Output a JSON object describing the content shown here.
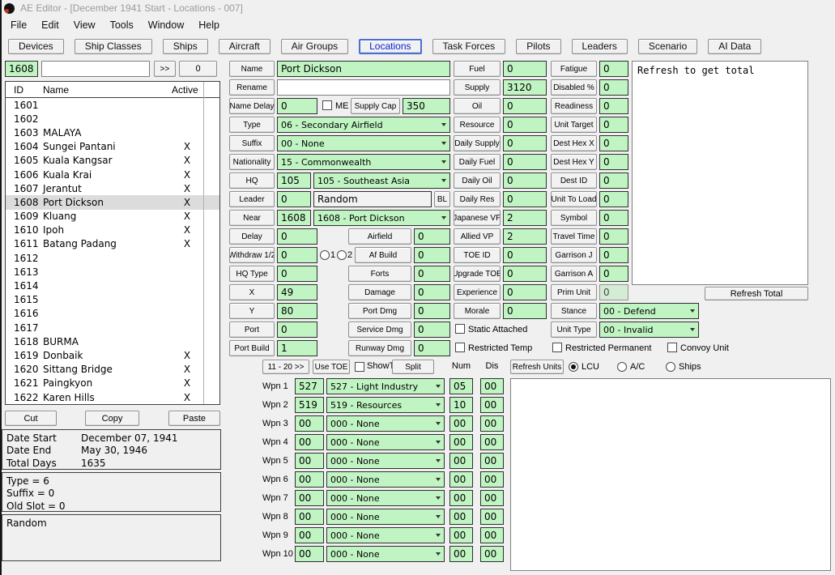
{
  "window": {
    "title": "AE Editor - [December 1941 Start - Locations - 007]"
  },
  "menu": {
    "items": [
      "File",
      "Edit",
      "View",
      "Tools",
      "Window",
      "Help"
    ]
  },
  "tabs": {
    "items": [
      {
        "label": "Devices"
      },
      {
        "label": "Ship Classes"
      },
      {
        "label": "Ships"
      },
      {
        "label": "Aircraft"
      },
      {
        "label": "Air Groups"
      },
      {
        "label": "Locations",
        "active": true
      },
      {
        "label": "Task Forces"
      },
      {
        "label": "Pilots"
      },
      {
        "label": "Leaders"
      },
      {
        "label": "Scenario"
      },
      {
        "label": "AI Data"
      }
    ]
  },
  "left": {
    "id_value": "1608",
    "search_value": "",
    "goto_label": ">>",
    "count_label": "0",
    "table": {
      "headers": {
        "id": "ID",
        "name": "Name",
        "active": "Active"
      },
      "rows": [
        {
          "id": "1601",
          "name": "",
          "active": ""
        },
        {
          "id": "1602",
          "name": "",
          "active": ""
        },
        {
          "id": "1603",
          "name": "MALAYA",
          "active": ""
        },
        {
          "id": "1604",
          "name": "Sungei Pantani",
          "active": "X"
        },
        {
          "id": "1605",
          "name": "Kuala Kangsar",
          "active": "X"
        },
        {
          "id": "1606",
          "name": "Kuala Krai",
          "active": "X"
        },
        {
          "id": "1607",
          "name": "Jerantut",
          "active": "X"
        },
        {
          "id": "1608",
          "name": "Port Dickson",
          "active": "X",
          "selected": true
        },
        {
          "id": "1609",
          "name": "Kluang",
          "active": "X"
        },
        {
          "id": "1610",
          "name": "Ipoh",
          "active": "X"
        },
        {
          "id": "1611",
          "name": "Batang Padang",
          "active": "X"
        },
        {
          "id": "1612",
          "name": "",
          "active": ""
        },
        {
          "id": "1613",
          "name": "",
          "active": ""
        },
        {
          "id": "1614",
          "name": "",
          "active": ""
        },
        {
          "id": "1615",
          "name": "",
          "active": ""
        },
        {
          "id": "1616",
          "name": "",
          "active": ""
        },
        {
          "id": "1617",
          "name": "",
          "active": ""
        },
        {
          "id": "1618",
          "name": "BURMA",
          "active": ""
        },
        {
          "id": "1619",
          "name": "Donbaik",
          "active": "X"
        },
        {
          "id": "1620",
          "name": "Sittang Bridge",
          "active": "X"
        },
        {
          "id": "1621",
          "name": "Paingkyon",
          "active": "X"
        },
        {
          "id": "1622",
          "name": "Karen Hills",
          "active": "X"
        }
      ]
    },
    "actions": {
      "cut": "Cut",
      "copy": "Copy",
      "paste": "Paste"
    },
    "dates": [
      {
        "label": "Date Start",
        "value": "December 07, 1941"
      },
      {
        "label": "Date End",
        "value": "May 30, 1946"
      },
      {
        "label": "Total Days",
        "value": "1635"
      }
    ],
    "info_lines": [
      "Type = 6",
      "Suffix = 0",
      "Old Slot = 0"
    ],
    "random_label": "Random"
  },
  "main": {
    "name": {
      "label": "Name",
      "value": "Port Dickson"
    },
    "rename": {
      "label": "Rename",
      "value": ""
    },
    "name_delay": {
      "label": "Name Delay",
      "value": "0"
    },
    "me_label": "ME",
    "supply_cap": {
      "label": "Supply Cap",
      "value": "350"
    },
    "type": {
      "label": "Type",
      "value": "06 - Secondary Airfield"
    },
    "suffix": {
      "label": "Suffix",
      "value": "00 - None"
    },
    "nationality": {
      "label": "Nationality",
      "value": "15 - Commonwealth"
    },
    "hq": {
      "label": "HQ",
      "id": "105",
      "value": "105 - Southeast Asia"
    },
    "leader": {
      "label": "Leader",
      "id": "0",
      "value": "Random",
      "bl_label": "BL"
    },
    "near": {
      "label": "Near",
      "id": "1608",
      "value": "1608 - Port Dickson"
    },
    "delay": {
      "label": "Delay",
      "value": "0"
    },
    "withdraw": {
      "label": "Withdraw 1/2",
      "value": "0",
      "radio1": "1",
      "radio2": "2"
    },
    "hq_type": {
      "label": "HQ Type",
      "value": "0"
    },
    "x": {
      "label": "X",
      "value": "49"
    },
    "y": {
      "label": "Y",
      "value": "80"
    },
    "port": {
      "label": "Port",
      "value": "0"
    },
    "port_build": {
      "label": "Port Build",
      "value": "1"
    },
    "airfield": {
      "label": "Airfield",
      "value": "0"
    },
    "af_build": {
      "label": "Af Build",
      "value": "0"
    },
    "forts": {
      "label": "Forts",
      "value": "0"
    },
    "damage": {
      "label": "Damage",
      "value": "0"
    },
    "port_dmg": {
      "label": "Port Dmg",
      "value": "0"
    },
    "service_dmg": {
      "label": "Service Dmg",
      "value": "0"
    },
    "runway_dmg": {
      "label": "Runway Dmg",
      "value": "0"
    }
  },
  "middle": {
    "fields": [
      {
        "label": "Fuel",
        "value": "0"
      },
      {
        "label": "Supply",
        "value": "3120"
      },
      {
        "label": "Oil",
        "value": "0"
      },
      {
        "label": "Resource",
        "value": "0"
      },
      {
        "label": "Daily Supply",
        "value": "0"
      },
      {
        "label": "Daily Fuel",
        "value": "0"
      },
      {
        "label": "Daily Oil",
        "value": "0"
      },
      {
        "label": "Daily Res",
        "value": "0"
      },
      {
        "label": "Japanese VP",
        "value": "2"
      },
      {
        "label": "Allied VP",
        "value": "2"
      },
      {
        "label": "TOE ID",
        "value": "0"
      },
      {
        "label": "Upgrade TOE",
        "value": "0"
      },
      {
        "label": "Experience",
        "value": "0"
      },
      {
        "label": "Morale",
        "value": "0"
      }
    ],
    "static_attached_label": "Static Attached",
    "restricted_temp_label": "Restricted Temp"
  },
  "right": {
    "fields": [
      {
        "label": "Fatigue",
        "value": "0"
      },
      {
        "label": "Disabled %",
        "value": "0"
      },
      {
        "label": "Readiness",
        "value": "0"
      },
      {
        "label": "Unit Target",
        "value": "0"
      },
      {
        "label": "Dest Hex X",
        "value": "0"
      },
      {
        "label": "Dest Hex Y",
        "value": "0"
      },
      {
        "label": "Dest ID",
        "value": "0"
      },
      {
        "label": "Unit To Load",
        "value": "0"
      },
      {
        "label": "Symbol",
        "value": "0"
      },
      {
        "label": "Travel Time",
        "value": "0"
      },
      {
        "label": "Garrison J",
        "value": "0"
      },
      {
        "label": "Garrison A",
        "value": "0"
      },
      {
        "label": "Prim Unit",
        "value": "0",
        "muted": true
      }
    ],
    "stance": {
      "label": "Stance",
      "value": "00 - Defend"
    },
    "unit_type": {
      "label": "Unit Type",
      "value": "00 - Invalid"
    },
    "restricted_permanent_label": "Restricted Permanent",
    "convoy_unit_label": "Convoy Unit"
  },
  "notes": {
    "text": "Refresh to get total",
    "refresh_total_label": "Refresh Total"
  },
  "toe": {
    "range_label": "11 - 20 >>",
    "use_toe_label": "Use TOE",
    "show_toe_label": "ShowTOE",
    "split_label": "Split",
    "num_label": "Num",
    "dis_label": "Dis",
    "refresh_units_label": "Refresh Units",
    "radios": [
      {
        "label": "LCU",
        "selected": true
      },
      {
        "label": "A/C"
      },
      {
        "label": "Ships"
      }
    ]
  },
  "weapons": {
    "rows": [
      {
        "label": "Wpn 1",
        "id": "527",
        "option": "527 - Light Industry",
        "num": "05",
        "dis": "00"
      },
      {
        "label": "Wpn 2",
        "id": "519",
        "option": "519 - Resources",
        "num": "10",
        "dis": "00"
      },
      {
        "label": "Wpn 3",
        "id": "00",
        "option": "000 - None",
        "num": "00",
        "dis": "00"
      },
      {
        "label": "Wpn 4",
        "id": "00",
        "option": "000 - None",
        "num": "00",
        "dis": "00"
      },
      {
        "label": "Wpn 5",
        "id": "00",
        "option": "000 - None",
        "num": "00",
        "dis": "00"
      },
      {
        "label": "Wpn 6",
        "id": "00",
        "option": "000 - None",
        "num": "00",
        "dis": "00"
      },
      {
        "label": "Wpn 7",
        "id": "00",
        "option": "000 - None",
        "num": "00",
        "dis": "00"
      },
      {
        "label": "Wpn 8",
        "id": "00",
        "option": "000 - None",
        "num": "00",
        "dis": "00"
      },
      {
        "label": "Wpn 9",
        "id": "00",
        "option": "000 - None",
        "num": "00",
        "dis": "00"
      },
      {
        "label": "Wpn 10",
        "id": "00",
        "option": "000 - None",
        "num": "00",
        "dis": "00"
      }
    ]
  }
}
